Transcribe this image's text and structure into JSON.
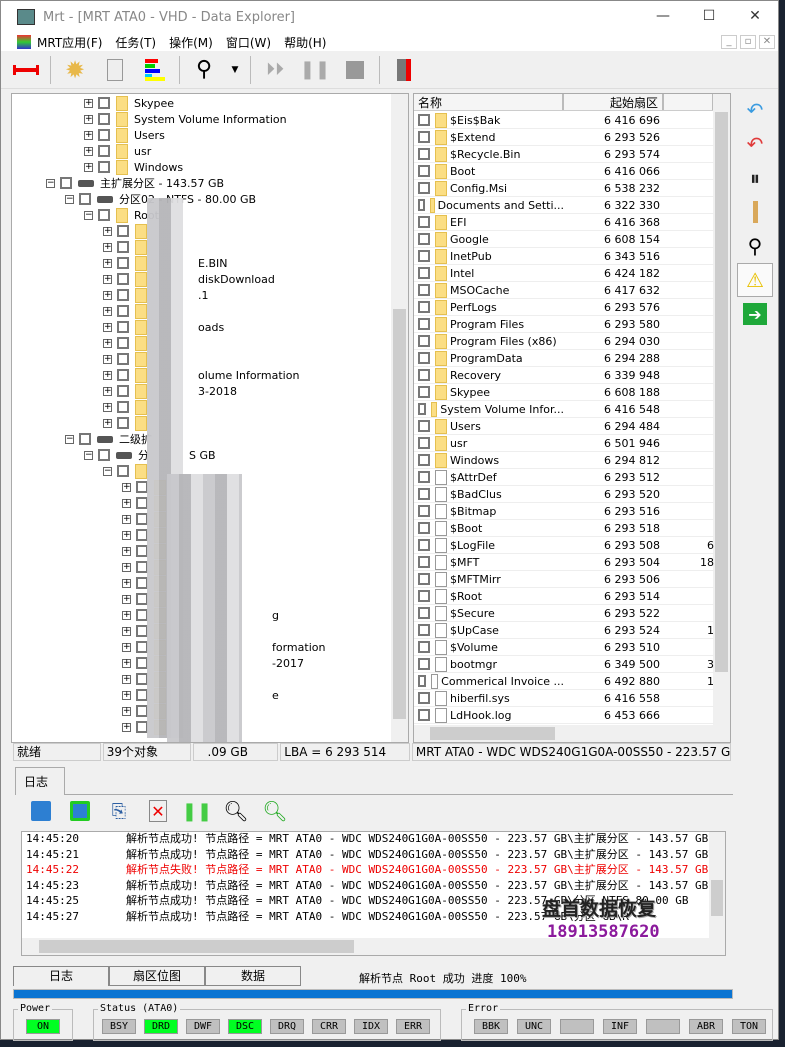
{
  "window": {
    "title": "Mrt - [MRT ATA0 - VHD - Data Explorer]",
    "minimize": "—",
    "maximize": "☐",
    "close": "✕"
  },
  "menu": [
    "MRT应用(F)",
    "任务(T)",
    "操作(M)",
    "窗口(W)",
    "帮助(H)"
  ],
  "tree": {
    "top_items": [
      "Skypee",
      "System Volume Information",
      "Users",
      "usr",
      "Windows"
    ],
    "ext_partition": "主扩展分区 - 143.57 GB",
    "partition02": "分区02 - NTFS - 80.00 GB",
    "root": "Root",
    "root_children": [
      "",
      "",
      "E.BIN",
      "diskDownload",
      ".1",
      "",
      "oads",
      "",
      "",
      "olume Information",
      "3-2018",
      "",
      ""
    ],
    "second_ext": "二级扩",
    "second_partition": "分",
    "second_partition_suffix": "S          GB",
    "second_children": [
      "",
      "",
      "",
      "",
      "",
      "",
      "",
      "",
      "g",
      "",
      "formation",
      "-2017",
      "",
      "e",
      "",
      ""
    ]
  },
  "list": {
    "columns": [
      "名称",
      "起始扇区",
      ""
    ],
    "rows": [
      {
        "name": "$Eis$Bak",
        "sector": "6 416 696",
        "extra": "",
        "type": "folder"
      },
      {
        "name": "$Extend",
        "sector": "6 293 526",
        "extra": "",
        "type": "folder"
      },
      {
        "name": "$Recycle.Bin",
        "sector": "6 293 574",
        "extra": "",
        "type": "folder"
      },
      {
        "name": "Boot",
        "sector": "6 416 066",
        "extra": "",
        "type": "folder"
      },
      {
        "name": "Config.Msi",
        "sector": "6 538 232",
        "extra": "",
        "type": "folder"
      },
      {
        "name": "Documents and Setti...",
        "sector": "6 322 330",
        "extra": "",
        "type": "folder"
      },
      {
        "name": "EFI",
        "sector": "6 416 368",
        "extra": "",
        "type": "folder"
      },
      {
        "name": "Google",
        "sector": "6 608 154",
        "extra": "",
        "type": "folder"
      },
      {
        "name": "InetPub",
        "sector": "6 343 516",
        "extra": "",
        "type": "folder"
      },
      {
        "name": "Intel",
        "sector": "6 424 182",
        "extra": "",
        "type": "folder"
      },
      {
        "name": "MSOCache",
        "sector": "6 417 632",
        "extra": "",
        "type": "folder"
      },
      {
        "name": "PerfLogs",
        "sector": "6 293 576",
        "extra": "",
        "type": "folder"
      },
      {
        "name": "Program Files",
        "sector": "6 293 580",
        "extra": "",
        "type": "folder"
      },
      {
        "name": "Program Files (x86)",
        "sector": "6 294 030",
        "extra": "",
        "type": "folder"
      },
      {
        "name": "ProgramData",
        "sector": "6 294 288",
        "extra": "",
        "type": "folder"
      },
      {
        "name": "Recovery",
        "sector": "6 339 948",
        "extra": "",
        "type": "folder"
      },
      {
        "name": "Skypee",
        "sector": "6 608 188",
        "extra": "",
        "type": "folder"
      },
      {
        "name": "System Volume Infor...",
        "sector": "6 416 548",
        "extra": "",
        "type": "folder"
      },
      {
        "name": "Users",
        "sector": "6 294 484",
        "extra": "",
        "type": "folder"
      },
      {
        "name": "usr",
        "sector": "6 501 946",
        "extra": "",
        "type": "folder"
      },
      {
        "name": "Windows",
        "sector": "6 294 812",
        "extra": "",
        "type": "folder"
      },
      {
        "name": "$AttrDef",
        "sector": "6 293 512",
        "extra": "",
        "type": "file"
      },
      {
        "name": "$BadClus",
        "sector": "6 293 520",
        "extra": "",
        "type": "file"
      },
      {
        "name": "$Bitmap",
        "sector": "6 293 516",
        "extra": "",
        "type": "file"
      },
      {
        "name": "$Boot",
        "sector": "6 293 518",
        "extra": "",
        "type": "file"
      },
      {
        "name": "$LogFile",
        "sector": "6 293 508",
        "extra": "6",
        "type": "file"
      },
      {
        "name": "$MFT",
        "sector": "6 293 504",
        "extra": "18",
        "type": "file"
      },
      {
        "name": "$MFTMirr",
        "sector": "6 293 506",
        "extra": "",
        "type": "file"
      },
      {
        "name": "$Root",
        "sector": "6 293 514",
        "extra": "",
        "type": "file"
      },
      {
        "name": "$Secure",
        "sector": "6 293 522",
        "extra": "",
        "type": "file"
      },
      {
        "name": "$UpCase",
        "sector": "6 293 524",
        "extra": "1",
        "type": "file"
      },
      {
        "name": "$Volume",
        "sector": "6 293 510",
        "extra": "",
        "type": "file"
      },
      {
        "name": "bootmgr",
        "sector": "6 349 500",
        "extra": "3",
        "type": "file"
      },
      {
        "name": "Commerical Invoice ...",
        "sector": "6 492 880",
        "extra": "1",
        "type": "pdf"
      },
      {
        "name": "hiberfil.sys",
        "sector": "6 416 558",
        "extra": "",
        "type": "sys"
      },
      {
        "name": "LdHook.log",
        "sector": "6 453 666",
        "extra": "",
        "type": "log"
      }
    ]
  },
  "status": {
    "ready": "就绪",
    "objects": "39个对象",
    "size": ".09 GB",
    "lba": "LBA = 6 293 514",
    "device": "MRT ATA0 - WDC WDS240G1G0A-00SS50 - 223.57 GB\\"
  },
  "log_tab": "日志",
  "log": [
    {
      "time": "14:45:20",
      "text": "解析节点成功!  节点路径 = MRT ATA0 - WDC WDS240G1G0A-00SS50 - 223.57 GB\\主扩展分区 - 143.57 GB\\二级",
      "error": false
    },
    {
      "time": "14:45:21",
      "text": "解析节点成功!  节点路径 = MRT ATA0 - WDC WDS240G1G0A-00SS50 - 223.57 GB\\主扩展分区 - 143.57 GB\\二级",
      "error": false
    },
    {
      "time": "14:45:22",
      "text": "解析节点失败!    节点路径 = MRT ATA0 - WDC WDS240G1G0A-00SS50 - 223.57 GB\\主扩展分区 - 143.57 GB\\二",
      "error": true
    },
    {
      "time": "14:45:23",
      "text": "解析节点成功!  节点路径 = MRT ATA0 - WDC WDS240G1G0A-00SS50 - 223.57 GB\\主扩展分区 - 143.57 GB\\分区",
      "error": false
    },
    {
      "time": "14:45:25",
      "text": "解析节点成功!  节点路径 = MRT ATA0 - WDC WDS240G1G0A-00SS50 - 223.57 GB\\分区    NTFS   80.00 GB",
      "error": false
    },
    {
      "time": "14:45:27",
      "text": "解析节点成功!  节点路径 = MRT ATA0 - WDC WDS240G1G0A-00SS50 - 223.57 GB\\分区              GB\\R",
      "error": false
    }
  ],
  "watermark": {
    "name": "盘首数据恢复",
    "phone": "18913587620"
  },
  "bottom_tabs": [
    "日志",
    "扇区位图",
    "数据"
  ],
  "bottom_status": "解析节点 Root 成功  进度 100%",
  "progress_percent": 100,
  "power": {
    "label": "Power",
    "on": "ON"
  },
  "status_group": {
    "label": "Status (ATA0)",
    "flags": [
      {
        "name": "BSY",
        "on": false
      },
      {
        "name": "DRD",
        "on": true
      },
      {
        "name": "DWF",
        "on": false
      },
      {
        "name": "DSC",
        "on": true
      },
      {
        "name": "DRQ",
        "on": false
      },
      {
        "name": "CRR",
        "on": false
      },
      {
        "name": "IDX",
        "on": false
      },
      {
        "name": "ERR",
        "on": false
      }
    ]
  },
  "error_group": {
    "label": "Error",
    "flags": [
      {
        "name": "BBK",
        "on": false
      },
      {
        "name": "UNC",
        "on": false
      },
      {
        "name": "",
        "on": false
      },
      {
        "name": "INF",
        "on": false
      },
      {
        "name": "",
        "on": false
      },
      {
        "name": "ABR",
        "on": false
      },
      {
        "name": "TON",
        "on": false
      }
    ]
  },
  "colors": {
    "accent": "#0a74d2",
    "on": "#00ff22",
    "error": "#ee0000"
  }
}
